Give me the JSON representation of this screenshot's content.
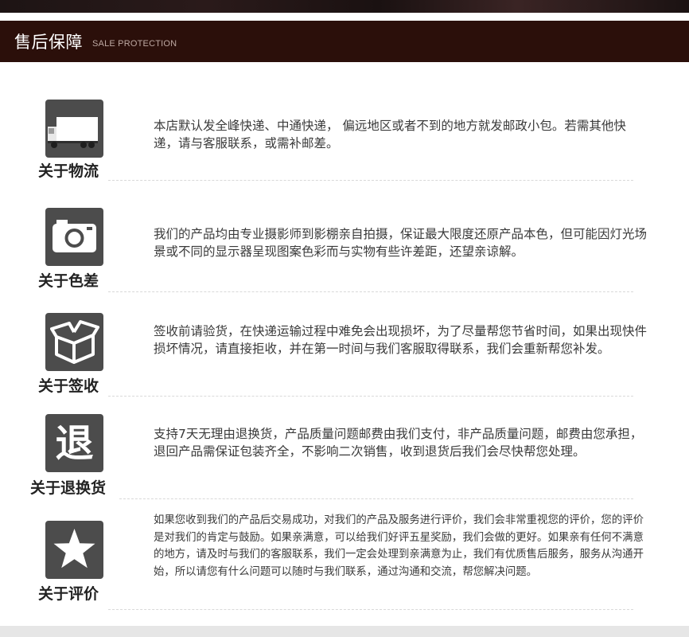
{
  "header": {
    "title": "售后保障",
    "subtitle": "SALE PROTECTION"
  },
  "sections": [
    {
      "icon": "truck-icon",
      "label": "关于物流",
      "text": "本店默认发全峰快递、中通快递， 偏远地区或者不到的地方就发邮政小包。若需其他快递，请与客服联系，或需补邮差。"
    },
    {
      "icon": "camera-icon",
      "label": "关于色差",
      "text": "我们的产品均由专业摄影师到影棚亲自拍摄，保证最大限度还原产品本色，但可能因灯光场景或不同的显示器呈现图案色彩而与实物有些许差距，还望亲谅解。"
    },
    {
      "icon": "open-box-icon",
      "label": "关于签收",
      "text": "签收前请验货，在快递运输过程中难免会出现损坏，为了尽量帮您节省时间，如果出现快件损坏情况，请直接拒收，并在第一时间与我们客服取得联系，我们会重新帮您补发。"
    },
    {
      "icon": "return-icon",
      "icon_glyph": "退",
      "label": "关于退换货",
      "text": "支持7天无理由退换货，产品质量问题邮费由我们支付，非产品质量问题，邮费由您承担，退回产品需保证包装齐全，不影响二次销售，收到退货后我们会尽快帮您处理。"
    },
    {
      "icon": "star-icon",
      "label": "关于评价",
      "text": "如果您收到我们的产品后交易成功，对我们的产品及服务进行评价，我们会非常重视您的评价，您的评价是对我们的肯定与鼓励。如果亲满意，可以给我们好评五星奖励，我们会做的更好。如果亲有任何不满意的地方，请及时与我们的客服联系，我们一定会处理到亲满意为止，我们有优质售后服务，服务从沟通开始，所以请您有什么问题可以随时与我们联系，通过沟通和交流，帮您解决问题。"
    }
  ]
}
